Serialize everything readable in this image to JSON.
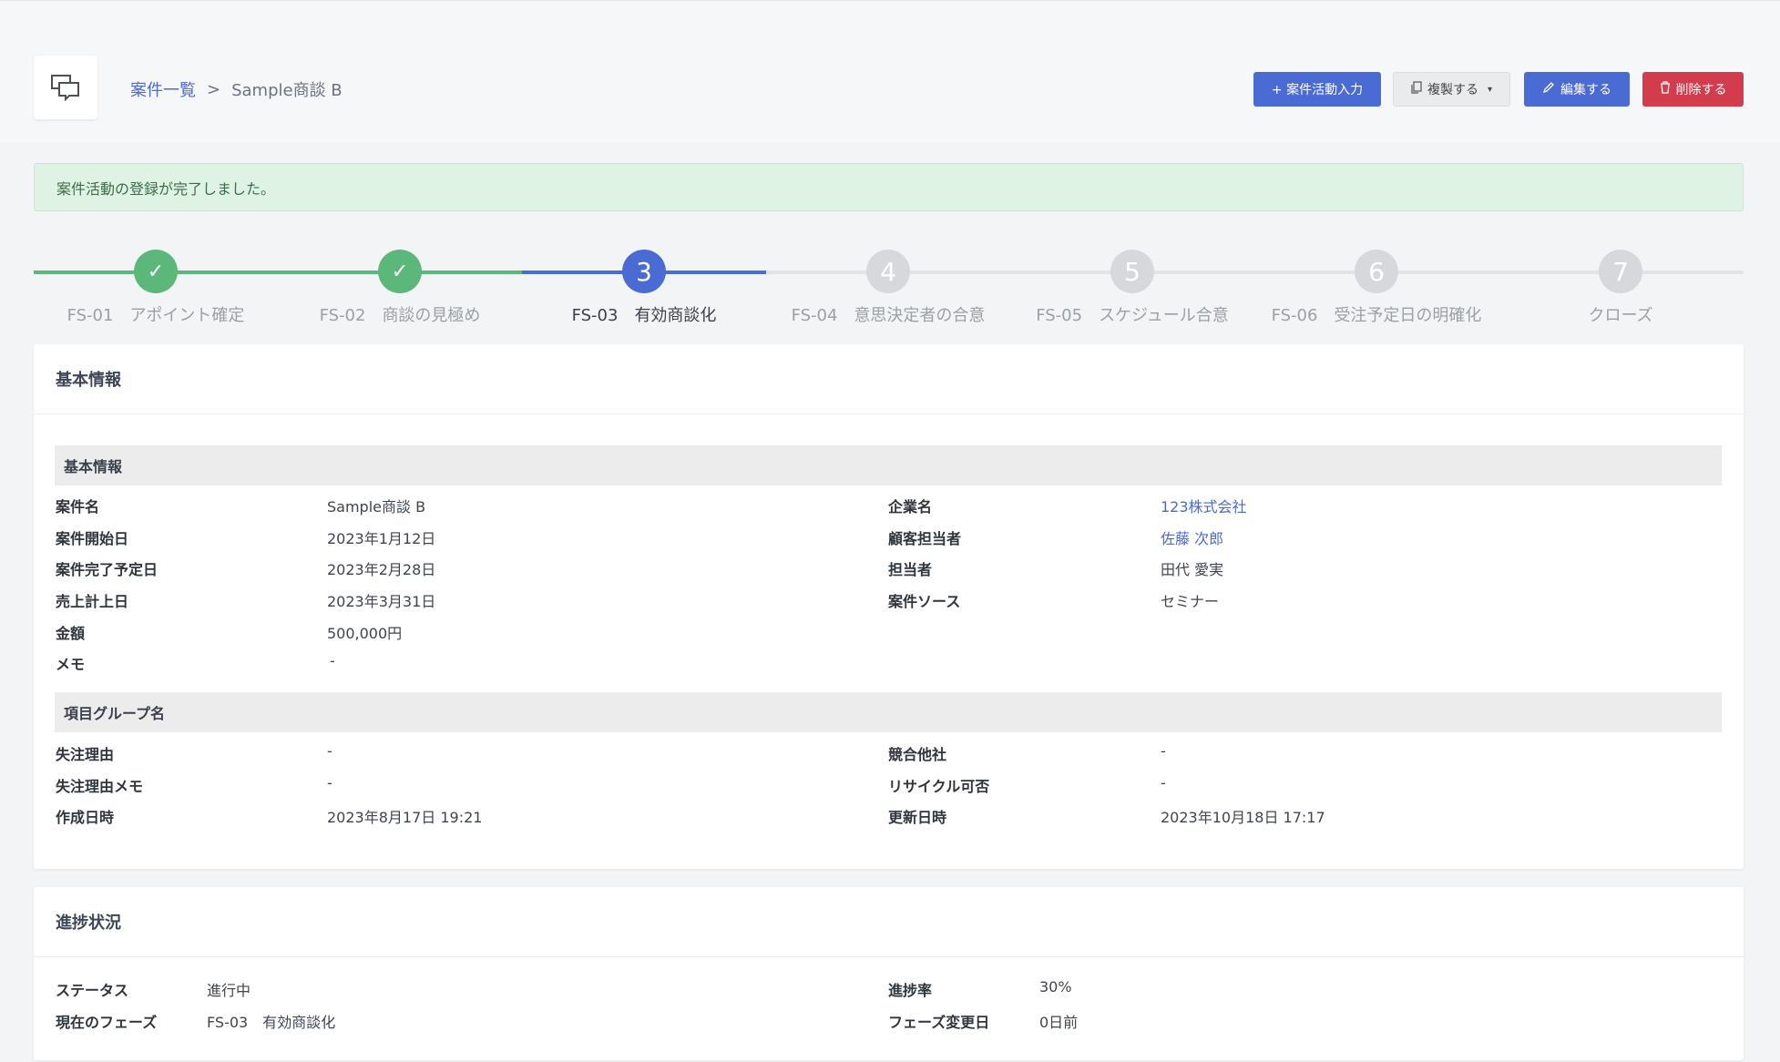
{
  "breadcrumb": {
    "parent": "案件一覧",
    "separator": ">",
    "current": "Sample商談 B"
  },
  "toolbar": {
    "add_activity": "+ 案件活動入力",
    "duplicate": "複製する",
    "edit": "編集する",
    "delete": "削除する"
  },
  "alert": {
    "message": "案件活動の登録が完了しました。"
  },
  "phases": [
    {
      "code": "FS-01",
      "name": "アポイント確定",
      "marker": "✓",
      "status": "completed"
    },
    {
      "code": "FS-02",
      "name": "商談の見極め",
      "marker": "✓",
      "status": "completed"
    },
    {
      "code": "FS-03",
      "name": "有効商談化",
      "marker": "3",
      "status": "current"
    },
    {
      "code": "FS-04",
      "name": "意思決定者の合意",
      "marker": "4",
      "status": "pending"
    },
    {
      "code": "FS-05",
      "name": "スケジュール合意",
      "marker": "5",
      "status": "pending"
    },
    {
      "code": "FS-06",
      "name": "受注予定日の明確化",
      "marker": "6",
      "status": "pending"
    },
    {
      "code": "",
      "name": "クローズ",
      "marker": "7",
      "status": "pending"
    }
  ],
  "basic_card": {
    "title": "基本情報",
    "section1_title": "基本情報",
    "section1": {
      "left": [
        {
          "label": "案件名",
          "value": "Sample商談 B"
        },
        {
          "label": "案件開始日",
          "value": "2023年1月12日"
        },
        {
          "label": "案件完了予定日",
          "value": "2023年2月28日"
        },
        {
          "label": "売上計上日",
          "value": "2023年3月31日"
        },
        {
          "label": "金額",
          "value": "500,000円"
        },
        {
          "label": "メモ",
          "value": "-"
        }
      ],
      "right": [
        {
          "label": "企業名",
          "value": "123株式会社"
        },
        {
          "label": "顧客担当者",
          "value": "佐藤 次郎"
        },
        {
          "label": "担当者",
          "value": "田代 愛実"
        },
        {
          "label": "案件ソース",
          "value": "セミナー"
        }
      ]
    },
    "section2_title": "項目グループ名",
    "section2": {
      "left": [
        {
          "label": "失注理由",
          "value": "-"
        },
        {
          "label": "失注理由メモ",
          "value": "-"
        },
        {
          "label": "作成日時",
          "value": "2023年8月17日 19:21"
        }
      ],
      "right": [
        {
          "label": "競合他社",
          "value": "-"
        },
        {
          "label": "リサイクル可否",
          "value": "-"
        },
        {
          "label": "更新日時",
          "value": "2023年10月18日 17:17"
        }
      ]
    }
  },
  "progress_card": {
    "title": "進捗状況",
    "left": [
      {
        "label": "ステータス",
        "value": "進行中"
      },
      {
        "label": "現在のフェーズ",
        "value": "FS-03　有効商談化"
      }
    ],
    "right": [
      {
        "label": "進捗率",
        "value": "30%"
      },
      {
        "label": "フェーズ変更日",
        "value": "0日前"
      }
    ]
  },
  "colors": {
    "accent": "#4b6bd4",
    "completed": "#5cb87a",
    "pending": "#d6d8dc",
    "danger": "#d23c4c",
    "link": "#4a6ad1"
  }
}
